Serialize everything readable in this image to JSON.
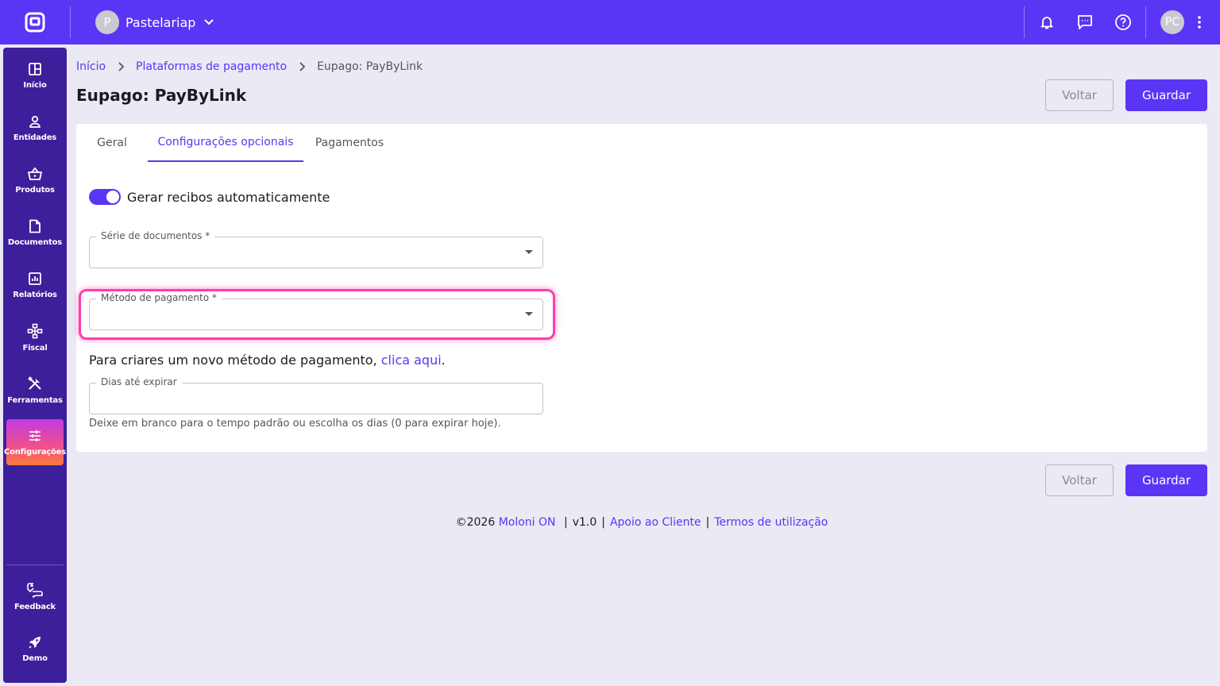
{
  "topbar": {
    "company_initial": "P",
    "company_name": "Pastelariap",
    "user_initials": "PC",
    "icons": [
      "app-logo-icon",
      "bell-icon",
      "chat-icon",
      "help-icon",
      "kebab-menu-icon"
    ]
  },
  "sidebar": {
    "items": [
      {
        "label": "Início",
        "icon": "dashboard-icon"
      },
      {
        "label": "Entidades",
        "icon": "person-icon"
      },
      {
        "label": "Produtos",
        "icon": "basket-icon"
      },
      {
        "label": "Documentos",
        "icon": "document-icon"
      },
      {
        "label": "Relatórios",
        "icon": "chart-icon"
      },
      {
        "label": "Fiscal",
        "icon": "hierarchy-icon"
      },
      {
        "label": "Ferramentas",
        "icon": "tools-icon"
      },
      {
        "label": "Configurações",
        "icon": "sliders-icon",
        "active": true
      }
    ],
    "bottom_items": [
      {
        "label": "Feedback",
        "icon": "feedback-icon"
      },
      {
        "label": "Demo",
        "icon": "rocket-icon"
      }
    ]
  },
  "breadcrumb": {
    "home": "Início",
    "parent": "Plataformas de pagamento",
    "current": "Eupago: PayByLink"
  },
  "page": {
    "title": "Eupago: PayByLink",
    "back_label": "Voltar",
    "save_label": "Guardar"
  },
  "tabs": [
    {
      "label": "Geral",
      "active": false
    },
    {
      "label": "Configurações opcionais",
      "active": true
    },
    {
      "label": "Pagamentos",
      "active": false
    }
  ],
  "form": {
    "auto_receipts": {
      "label": "Gerar recibos automaticamente",
      "enabled": true
    },
    "document_series": {
      "label": "Série de documentos",
      "required_mark": "*",
      "value": ""
    },
    "payment_method": {
      "label": "Método de pagamento",
      "required_mark": "*",
      "value": ""
    },
    "new_method_text": "Para criares um novo método de pagamento, ",
    "new_method_link": "clica aqui",
    "new_method_suffix": ".",
    "days_to_expire": {
      "label": "Dias até expirar",
      "value": ""
    },
    "days_hint": "Deixe em branco para o tempo padrão ou escolha os dias (0 para expirar hoje)."
  },
  "footer": {
    "copyright": "©2026",
    "brand": "Moloni ON",
    "sep": "|",
    "version": "v1.0",
    "support": "Apoio ao Cliente",
    "terms": "Termos de utilização"
  },
  "colors": {
    "primary": "#5a35f6",
    "sidebar": "#3d1f9b",
    "highlight": "#ff3dab",
    "background": "#eae9f4"
  }
}
